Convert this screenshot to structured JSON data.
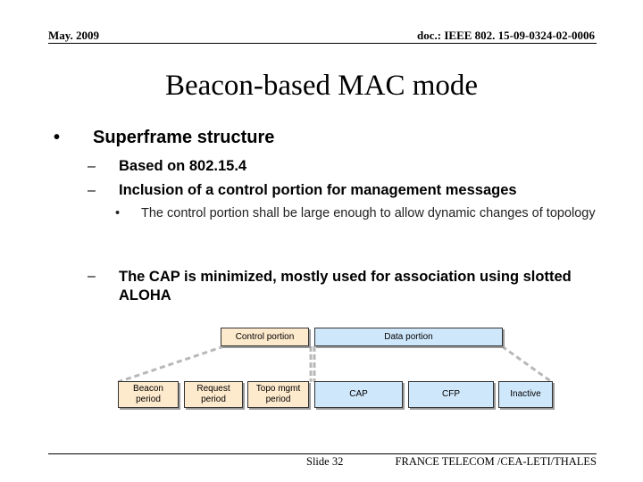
{
  "header": {
    "date": "May. 2009",
    "doc_id": "doc.: IEEE 802. 15-09-0324-02-0006"
  },
  "title": "Beacon-based MAC mode",
  "bullets": {
    "main": {
      "marker": "•",
      "text": "Superframe structure"
    },
    "sub": [
      {
        "marker": "–",
        "text": "Based on 802.15.4"
      },
      {
        "marker": "–",
        "text": "Inclusion of a control portion for management messages"
      },
      {
        "marker": "•",
        "text": "The control portion shall be large enough to allow dynamic changes of topology"
      },
      {
        "marker": "–",
        "text": "The CAP is minimized, mostly used for association using slotted ALOHA"
      }
    ]
  },
  "diagram": {
    "colors": {
      "control_fill": "#fde9cc",
      "data_fill": "#cfe7fb",
      "border": "#333333",
      "dashed_connector": "#b8b8b8"
    },
    "top_row": {
      "control_portion": "Control portion",
      "data_portion": "Data portion"
    },
    "bottom_row": {
      "beacon_period": "Beacon period",
      "request_period": "Request period",
      "topo_mgmt_period": "Topo mgmt period",
      "cap": "CAP",
      "cfp": "CFP",
      "inactive": "Inactive"
    }
  },
  "footer": {
    "slide": "Slide 32",
    "organization": "FRANCE TELECOM /CEA-LETI/THALES"
  }
}
